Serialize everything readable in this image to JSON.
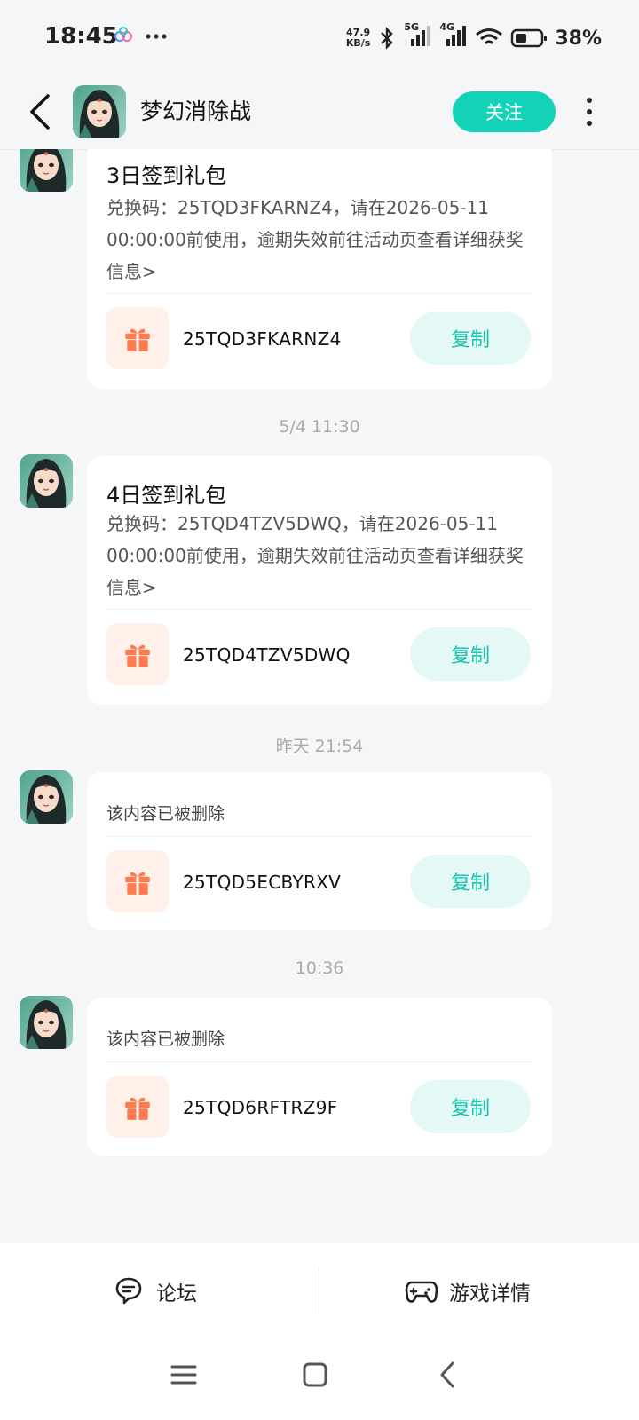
{
  "status_bar": {
    "time": "18:45",
    "network_speed_value": "47.9",
    "network_speed_unit": "KB/s",
    "signal_1": "5G",
    "signal_2": "4G",
    "battery": "38%"
  },
  "header": {
    "title": "梦幻消除战",
    "follow_label": "关注"
  },
  "messages": [
    {
      "title": "3日签到礼包",
      "body": "兑换码：25TQD3FKARNZ4，请在2026-05-11 00:00:00前使用，逾期失效前往活动页查看详细获奖信息>",
      "code": "25TQD3FKARNZ4",
      "copy_label": "复制"
    },
    {
      "timestamp": "5/4  11:30",
      "title": "4日签到礼包",
      "body": "兑换码：25TQD4TZV5DWQ，请在2026-05-11 00:00:00前使用，逾期失效前往活动页查看详细获奖信息>",
      "code": "25TQD4TZV5DWQ",
      "copy_label": "复制"
    },
    {
      "timestamp": "昨天  21:54",
      "deleted_text": "该内容已被删除",
      "code": "25TQD5ECBYRXV",
      "copy_label": "复制"
    },
    {
      "timestamp": "10:36",
      "deleted_text": "该内容已被删除",
      "code": "25TQD6RFTRZ9F",
      "copy_label": "复制"
    }
  ],
  "bottom_bar": {
    "forum_label": "论坛",
    "game_details_label": "游戏详情"
  },
  "colors": {
    "accent": "#14d2b8",
    "gift": "#ff7a4d",
    "background": "#f5f6f8"
  }
}
